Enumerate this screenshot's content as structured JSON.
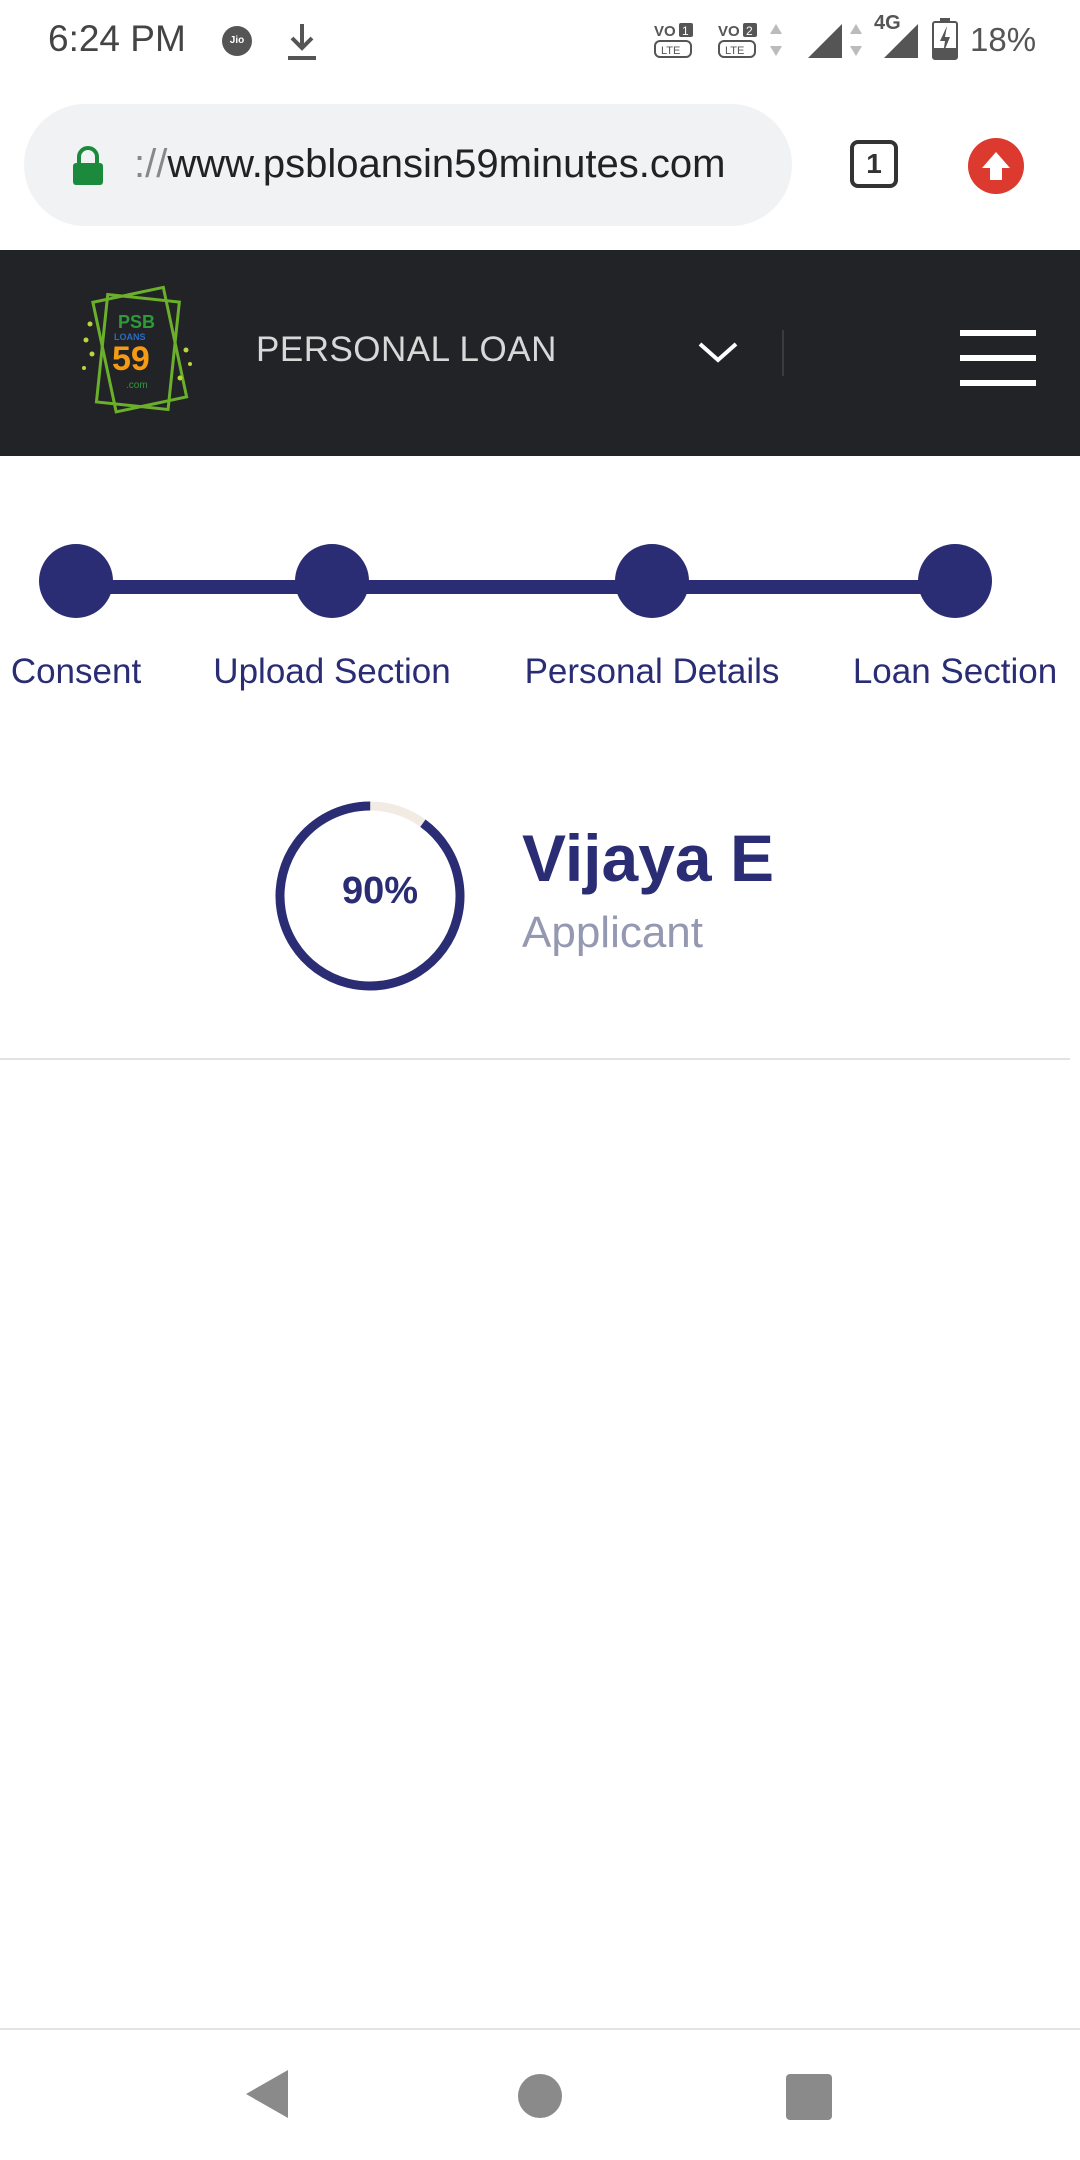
{
  "status_bar": {
    "time": "6:24 PM",
    "carrier_icon": "jio-icon",
    "carrier_label": "Jio",
    "network": "4G",
    "battery": "18%"
  },
  "browser": {
    "url_scheme": "://",
    "url_host": "www.psbloansin59minutes.com",
    "tab_count": "1"
  },
  "header": {
    "loan_type": "PERSONAL LOAN"
  },
  "stepper": {
    "steps": [
      {
        "label": "Consent"
      },
      {
        "label": "Upload Section"
      },
      {
        "label": "Personal Details"
      },
      {
        "label": "Loan Section"
      }
    ]
  },
  "applicant": {
    "progress_percent": 90,
    "progress_label": "90%",
    "name": "Vijaya E",
    "role": "Applicant"
  },
  "colors": {
    "primary": "#2a2d74",
    "header_bg": "#222326",
    "secondary_text": "#9498b1",
    "ring_track": "#f2ebe4",
    "update_badge": "#dc3a2e"
  }
}
